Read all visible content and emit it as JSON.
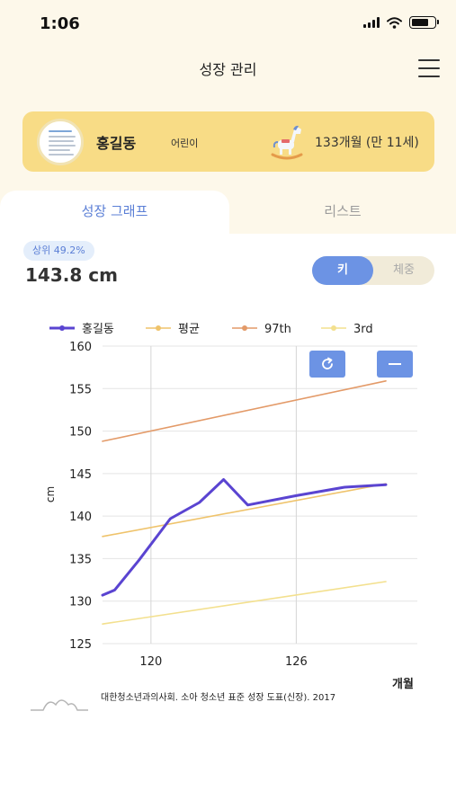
{
  "status_bar": {
    "time": "1:06",
    "battery_level": 0.75
  },
  "header": {
    "title": "성장 관리",
    "menu_icon": "hamburger-menu-icon"
  },
  "profile": {
    "name": "홍길동",
    "role": "어린이",
    "age": "133개월 (만 11세)",
    "avatar_icon": "certificate-avatar-icon",
    "mascot_icon": "rocking-horse-icon"
  },
  "tabs": [
    {
      "label": "성장 그래프",
      "active": true
    },
    {
      "label": "리스트",
      "active": false
    }
  ],
  "summary": {
    "percentile": "상위 49.2%",
    "value": "143.8 cm"
  },
  "toggle": {
    "height_label": "키",
    "weight_label": "체중",
    "selected": "키"
  },
  "chart_controls": {
    "refresh_icon": "refresh-icon",
    "zoom_out_icon": "minus-icon"
  },
  "chart_data": {
    "type": "line",
    "xlabel": "개월",
    "ylabel": "cm",
    "xlim": [
      118,
      131
    ],
    "ylim": [
      125,
      160
    ],
    "x_ticks": [
      120,
      126
    ],
    "y_ticks": [
      125,
      130,
      135,
      140,
      145,
      150,
      155,
      160
    ],
    "grid": "vertical lines at x ticks, horizontal lines at y ticks",
    "legend_position": "top",
    "series": [
      {
        "name": "홍길동",
        "color": "#5a44d1",
        "x": [
          118,
          118.5,
          119.5,
          120.8,
          122,
          123,
          124,
          126,
          128,
          129.7
        ],
        "y": [
          130.7,
          131.3,
          134.8,
          139.7,
          141.6,
          144.3,
          141.3,
          142.4,
          143.4,
          143.7
        ]
      },
      {
        "name": "평균",
        "color": "#efc36b",
        "x": [
          118,
          129.7
        ],
        "y": [
          137.6,
          143.8
        ]
      },
      {
        "name": "97th",
        "color": "#e39a68",
        "x": [
          118,
          129.7
        ],
        "y": [
          148.8,
          155.9
        ]
      },
      {
        "name": "3rd",
        "color": "#f3e08e",
        "x": [
          118,
          129.7
        ],
        "y": [
          127.3,
          132.3
        ]
      }
    ]
  },
  "footer": {
    "source": "대한청소년과의사회. 소아 청소년 표준 성장 도표(신장). 2017"
  }
}
